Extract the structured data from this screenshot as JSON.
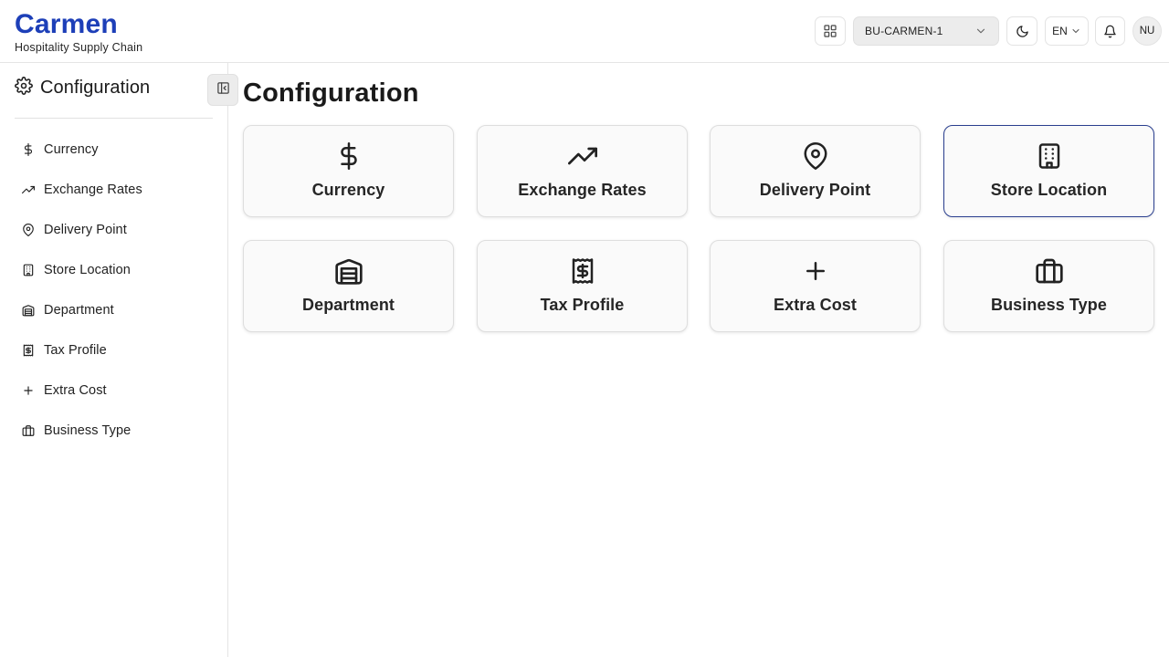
{
  "app": {
    "brand_title": "Carmen",
    "brand_subtitle": "Hospitality Supply Chain",
    "accent_color": "#1d3fb8"
  },
  "header": {
    "business_unit": "BU-CARMEN-1",
    "language": "EN",
    "avatar_initials": "NU",
    "icons": [
      "grid-icon",
      "chevron-down-icon",
      "moon-icon",
      "bell-icon"
    ]
  },
  "sidebar": {
    "title": "Configuration",
    "items": [
      {
        "label": "Currency",
        "icon": "dollar-icon"
      },
      {
        "label": "Exchange Rates",
        "icon": "trending-up-icon"
      },
      {
        "label": "Delivery Point",
        "icon": "map-pin-icon"
      },
      {
        "label": "Store Location",
        "icon": "building-icon"
      },
      {
        "label": "Department",
        "icon": "warehouse-icon"
      },
      {
        "label": "Tax Profile",
        "icon": "receipt-icon"
      },
      {
        "label": "Extra Cost",
        "icon": "plus-icon"
      },
      {
        "label": "Business Type",
        "icon": "briefcase-icon"
      }
    ]
  },
  "main": {
    "title": "Configuration",
    "active_card": "Store Location",
    "cards": [
      {
        "label": "Currency",
        "icon": "dollar-icon"
      },
      {
        "label": "Exchange Rates",
        "icon": "trending-up-icon"
      },
      {
        "label": "Delivery Point",
        "icon": "map-pin-icon"
      },
      {
        "label": "Store Location",
        "icon": "building-icon"
      },
      {
        "label": "Department",
        "icon": "warehouse-icon"
      },
      {
        "label": "Tax Profile",
        "icon": "receipt-icon"
      },
      {
        "label": "Extra Cost",
        "icon": "plus-icon"
      },
      {
        "label": "Business Type",
        "icon": "briefcase-icon"
      }
    ]
  }
}
